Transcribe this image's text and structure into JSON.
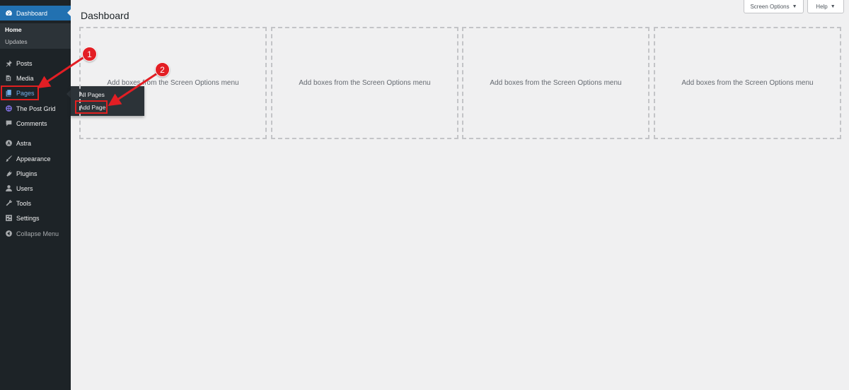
{
  "sidebar": {
    "items": [
      {
        "label": "Dashboard",
        "icon": "dashboard-icon"
      },
      {
        "label": "Posts",
        "icon": "pin-icon"
      },
      {
        "label": "Media",
        "icon": "media-icon"
      },
      {
        "label": "Pages",
        "icon": "pages-icon"
      },
      {
        "label": "The Post Grid",
        "icon": "post-grid-icon"
      },
      {
        "label": "Comments",
        "icon": "comment-icon"
      },
      {
        "label": "Astra",
        "icon": "astra-icon"
      },
      {
        "label": "Appearance",
        "icon": "brush-icon"
      },
      {
        "label": "Plugins",
        "icon": "plug-icon"
      },
      {
        "label": "Users",
        "icon": "user-icon"
      },
      {
        "label": "Tools",
        "icon": "wrench-icon"
      },
      {
        "label": "Settings",
        "icon": "settings-icon"
      },
      {
        "label": "Collapse Menu",
        "icon": "collapse-icon"
      }
    ],
    "submenu": {
      "home": "Home",
      "updates": "Updates"
    }
  },
  "flyout": {
    "all_pages": "All Pages",
    "add_page": "Add Page"
  },
  "header": {
    "title": "Dashboard",
    "screen_options": "Screen Options",
    "help": "Help"
  },
  "boxes": {
    "placeholder_1": "Add boxes from the Screen Options menu",
    "placeholder_2": "Add boxes from the Screen Options menu",
    "placeholder_3": "Add boxes from the Screen Options menu",
    "placeholder_4": "Add boxes from the Screen Options menu"
  },
  "annotations": {
    "step1": "1",
    "step2": "2",
    "color": "#e31e24"
  },
  "colors": {
    "sidebar_bg": "#1d2327",
    "accent": "#2271b1",
    "page_bg": "#f0f0f1"
  }
}
